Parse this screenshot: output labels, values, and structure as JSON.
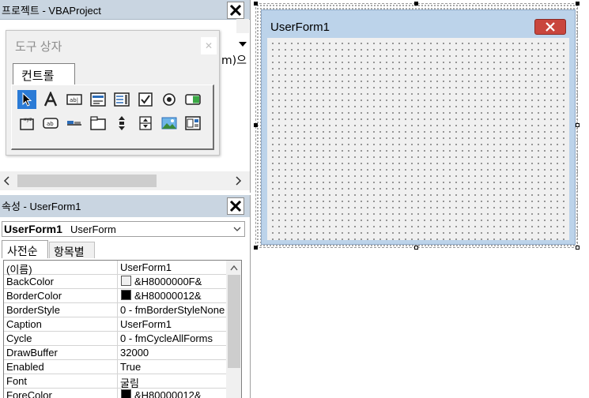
{
  "project": {
    "title": "프로젝트 - VBAProject",
    "code_peek": "m)으"
  },
  "toolbox": {
    "title": "도구 상자",
    "tab_label": "컨트롤",
    "tools": [
      {
        "icon": "select-objects-icon",
        "selected": true
      },
      {
        "icon": "label-icon"
      },
      {
        "icon": "textbox-icon"
      },
      {
        "icon": "combobox-icon"
      },
      {
        "icon": "listbox-icon"
      },
      {
        "icon": "checkbox-icon"
      },
      {
        "icon": "optionbutton-icon"
      },
      {
        "icon": "togglebutton-icon"
      },
      {
        "icon": "frame-icon"
      },
      {
        "icon": "commandbutton-icon"
      },
      {
        "icon": "tabstrip-icon"
      },
      {
        "icon": "multipage-icon"
      },
      {
        "icon": "scrollbar-icon"
      },
      {
        "icon": "spinbutton-icon"
      },
      {
        "icon": "image-icon"
      },
      {
        "icon": "refedit-icon"
      }
    ]
  },
  "properties": {
    "title": "속성 - UserForm1",
    "object_name": "UserForm1",
    "object_type": "UserForm",
    "tab_alphabetic": "사전순",
    "tab_categorized": "항목별",
    "rows": [
      {
        "name": "(이름)",
        "value": "UserForm1"
      },
      {
        "name": "BackColor",
        "value": "&H8000000F&",
        "swatch": "#f0f0f0"
      },
      {
        "name": "BorderColor",
        "value": "&H80000012&",
        "swatch": "#000000"
      },
      {
        "name": "BorderStyle",
        "value": "0 - fmBorderStyleNone"
      },
      {
        "name": "Caption",
        "value": "UserForm1"
      },
      {
        "name": "Cycle",
        "value": "0 - fmCycleAllForms"
      },
      {
        "name": "DrawBuffer",
        "value": "32000"
      },
      {
        "name": "Enabled",
        "value": "True"
      },
      {
        "name": "Font",
        "value": "굴림"
      },
      {
        "name": "ForeColor",
        "value": "&H80000012&",
        "swatch": "#000000"
      }
    ]
  },
  "designer": {
    "form_caption": "UserForm1"
  }
}
